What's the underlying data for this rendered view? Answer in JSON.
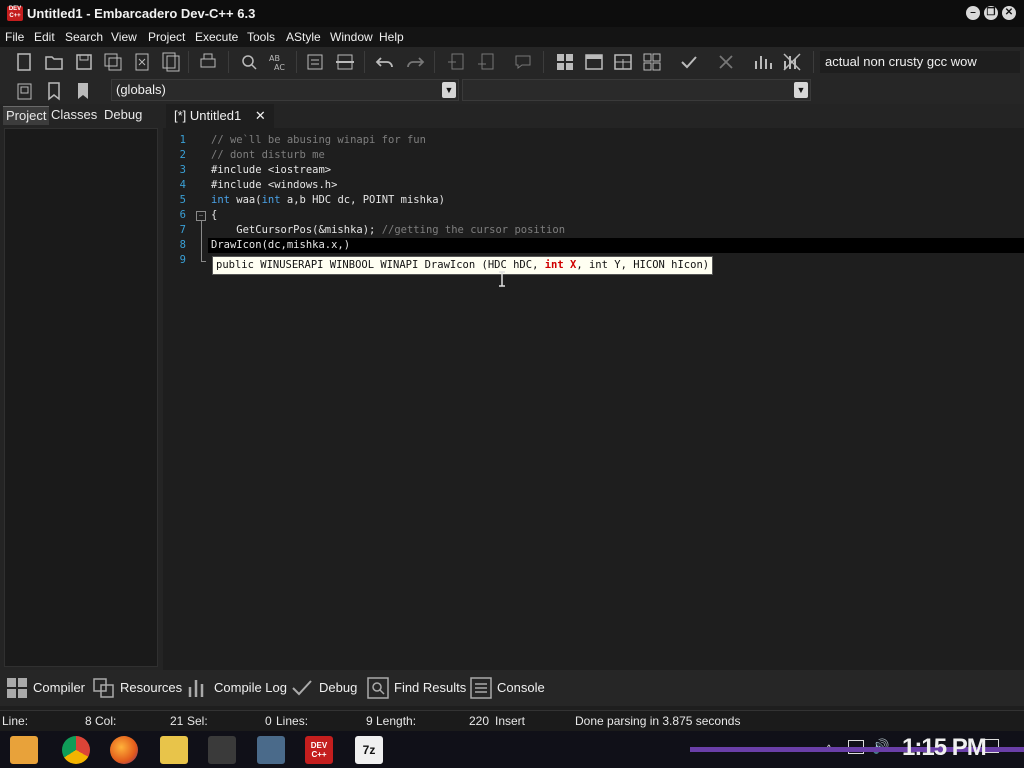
{
  "window": {
    "title": "Untitled1 - Embarcadero Dev-C++ 6.3",
    "app_icon_label": "DEV C++",
    "minimize_icon": "minimize-icon",
    "maximize_icon": "restore-icon",
    "close_icon": "close-icon"
  },
  "menu": [
    "File",
    "Edit",
    "Search",
    "View",
    "Project",
    "Execute",
    "Tools",
    "AStyle",
    "Window",
    "Help"
  ],
  "toolbar": {
    "compiler_select": "actual non crusty gcc wow",
    "scope_combo": "(globals)",
    "function_combo": ""
  },
  "left_panel": {
    "tabs": [
      "Project",
      "Classes",
      "Debug"
    ],
    "active_tab": "Project"
  },
  "editor": {
    "tab_label": "[*] Untitled1",
    "line_numbers": [
      "1",
      "2",
      "3",
      "4",
      "5",
      "6",
      "7",
      "8",
      "9"
    ],
    "lines": {
      "l1": "// we`ll be abusing winapi for fun",
      "l2": "// dont disturb me",
      "l3": "#include <iostream>",
      "l4": "#include <windows.h>",
      "l5_kw1": "int",
      "l5_a": " waa(",
      "l5_kw2": "int",
      "l5_b": " a,b HDC dc, POINT mishka)",
      "l6": "{",
      "l7_code": "    GetCursorPos(&mishka); ",
      "l7_comment": "//getting the cursor position",
      "l8": "DrawIcon(dc,mishka.x,)"
    },
    "tooltip": {
      "prefix": "public WINUSERAPI WINBOOL WINAPI DrawIcon (HDC hDC, ",
      "highlight": "int X",
      "suffix": ", int Y, HICON hIcon)"
    }
  },
  "bottom_tabs": [
    "Compiler",
    "Resources",
    "Compile Log",
    "Debug",
    "Find Results",
    "Console"
  ],
  "status": {
    "line_label": "Line:",
    "line_value": "8",
    "col_label": "Col:",
    "col_value": "21",
    "sel_label": "Sel:",
    "sel_value": "0",
    "lines_label": "Lines:",
    "lines_value": "9",
    "length_label": "Length:",
    "length_value": "220",
    "mode": "Insert",
    "message": "Done parsing in 3.875 seconds"
  },
  "taskbar": {
    "clock": "1:15 PM",
    "apps": [
      "start-icon",
      "chrome-icon",
      "firefox-icon",
      "file-explorer-icon",
      "audio-app-icon",
      "network-app-icon",
      "devcpp-icon",
      "7zip-icon"
    ],
    "devcpp_label": "DEV C++",
    "zip_label": "7z"
  },
  "colors": {
    "keyword": "#4aa3e8",
    "comment": "#7e7e7e",
    "line_number": "#3aa0d6",
    "tooltip_highlight": "#d00000",
    "taskbar_accent": "#6a3fa8"
  }
}
